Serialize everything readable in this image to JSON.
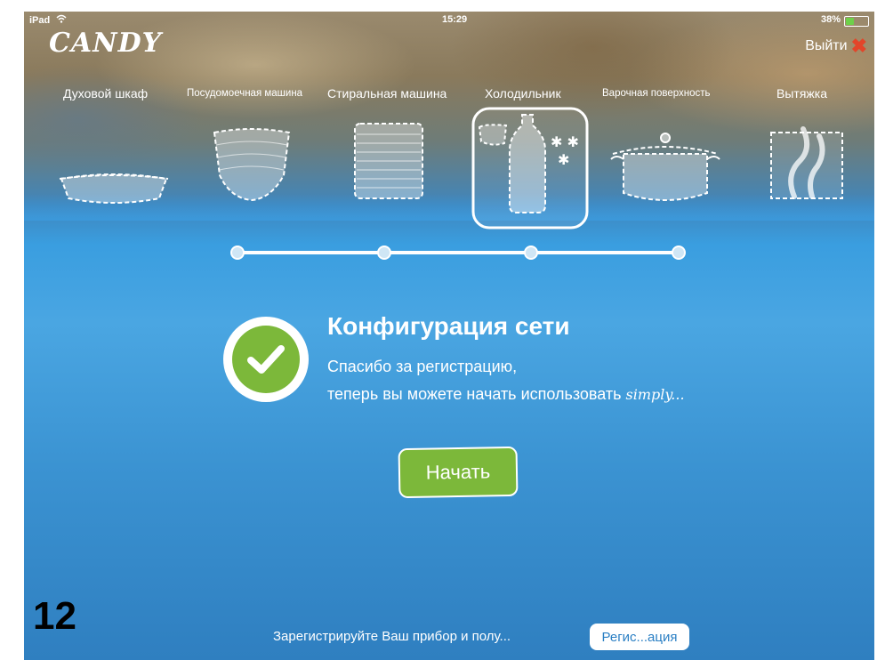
{
  "status_bar": {
    "device": "iPad",
    "time": "15:29",
    "battery": "38%",
    "battery_level": 0.38
  },
  "header": {
    "logo": "CANDY",
    "logout_label": "Выйти"
  },
  "categories": [
    {
      "label": "Духовой шкаф"
    },
    {
      "label": "Посудомоечная машина"
    },
    {
      "label": "Стиральная машина"
    },
    {
      "label": "Холодильник"
    },
    {
      "label": "Варочная поверхность"
    },
    {
      "label": "Вытяжка"
    }
  ],
  "selected_category": "Холодильник",
  "main": {
    "title": "Конфигурация сети",
    "line1": "Спасибо за регистрацию,",
    "line2": "теперь вы можете начать использовать ",
    "brand_word": "simply...",
    "start_label": "Начать"
  },
  "step_number": "12",
  "footer": {
    "text": "Зарегистрируйте Ваш прибор и полу...",
    "register_label": "Регис...ация"
  },
  "colors": {
    "accent_green": "#7cb83a",
    "close_red": "#e2452a",
    "background_blue": "#3a9ee0"
  }
}
